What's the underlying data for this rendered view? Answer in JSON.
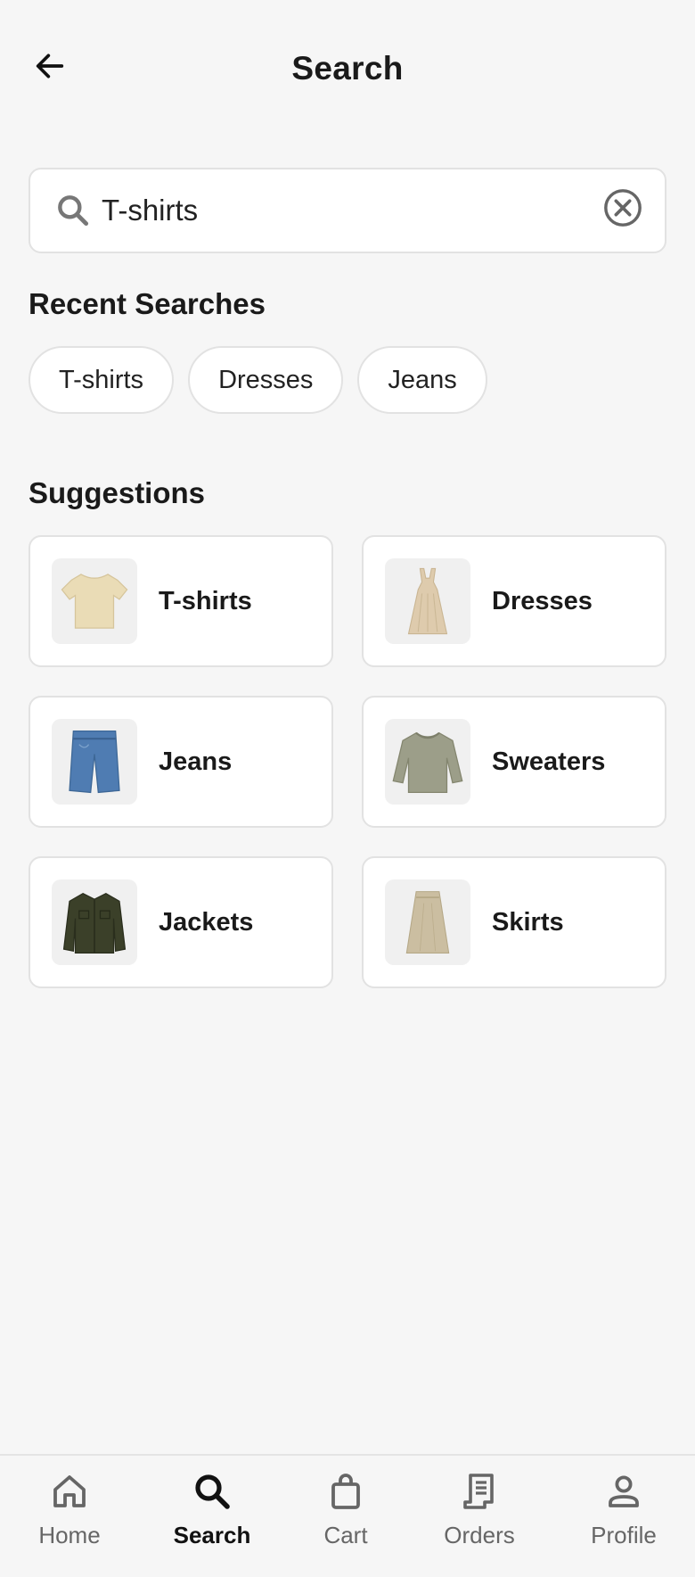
{
  "header": {
    "title": "Search",
    "back_icon": "arrow-left-icon"
  },
  "search": {
    "value": "T-shirts",
    "placeholder": "Search",
    "search_icon": "search-icon",
    "clear_icon": "clear-circle-icon"
  },
  "recent": {
    "title": "Recent Searches",
    "items": [
      "T-shirts",
      "Dresses",
      "Jeans"
    ]
  },
  "suggestions": {
    "title": "Suggestions",
    "items": [
      {
        "label": "T-shirts",
        "icon": "tshirt-image",
        "color": "#e9dcb8"
      },
      {
        "label": "Dresses",
        "icon": "dress-image",
        "color": "#dcc9ae"
      },
      {
        "label": "Jeans",
        "icon": "jeans-image",
        "color": "#4d78ad"
      },
      {
        "label": "Sweaters",
        "icon": "sweater-image",
        "color": "#9b9d88"
      },
      {
        "label": "Jackets",
        "icon": "jacket-image",
        "color": "#3a3f2a"
      },
      {
        "label": "Skirts",
        "icon": "skirt-image",
        "color": "#c9bca0"
      }
    ]
  },
  "nav": {
    "items": [
      {
        "label": "Home",
        "icon": "home-icon",
        "active": false
      },
      {
        "label": "Search",
        "icon": "search-icon",
        "active": true
      },
      {
        "label": "Cart",
        "icon": "shopping-bag-icon",
        "active": false
      },
      {
        "label": "Orders",
        "icon": "receipt-icon",
        "active": false
      },
      {
        "label": "Profile",
        "icon": "person-icon",
        "active": false
      }
    ]
  },
  "colors": {
    "background": "#f6f6f6",
    "card": "#ffffff",
    "border": "#e2e2e2",
    "text": "#1a1a1a",
    "muted": "#666666"
  }
}
